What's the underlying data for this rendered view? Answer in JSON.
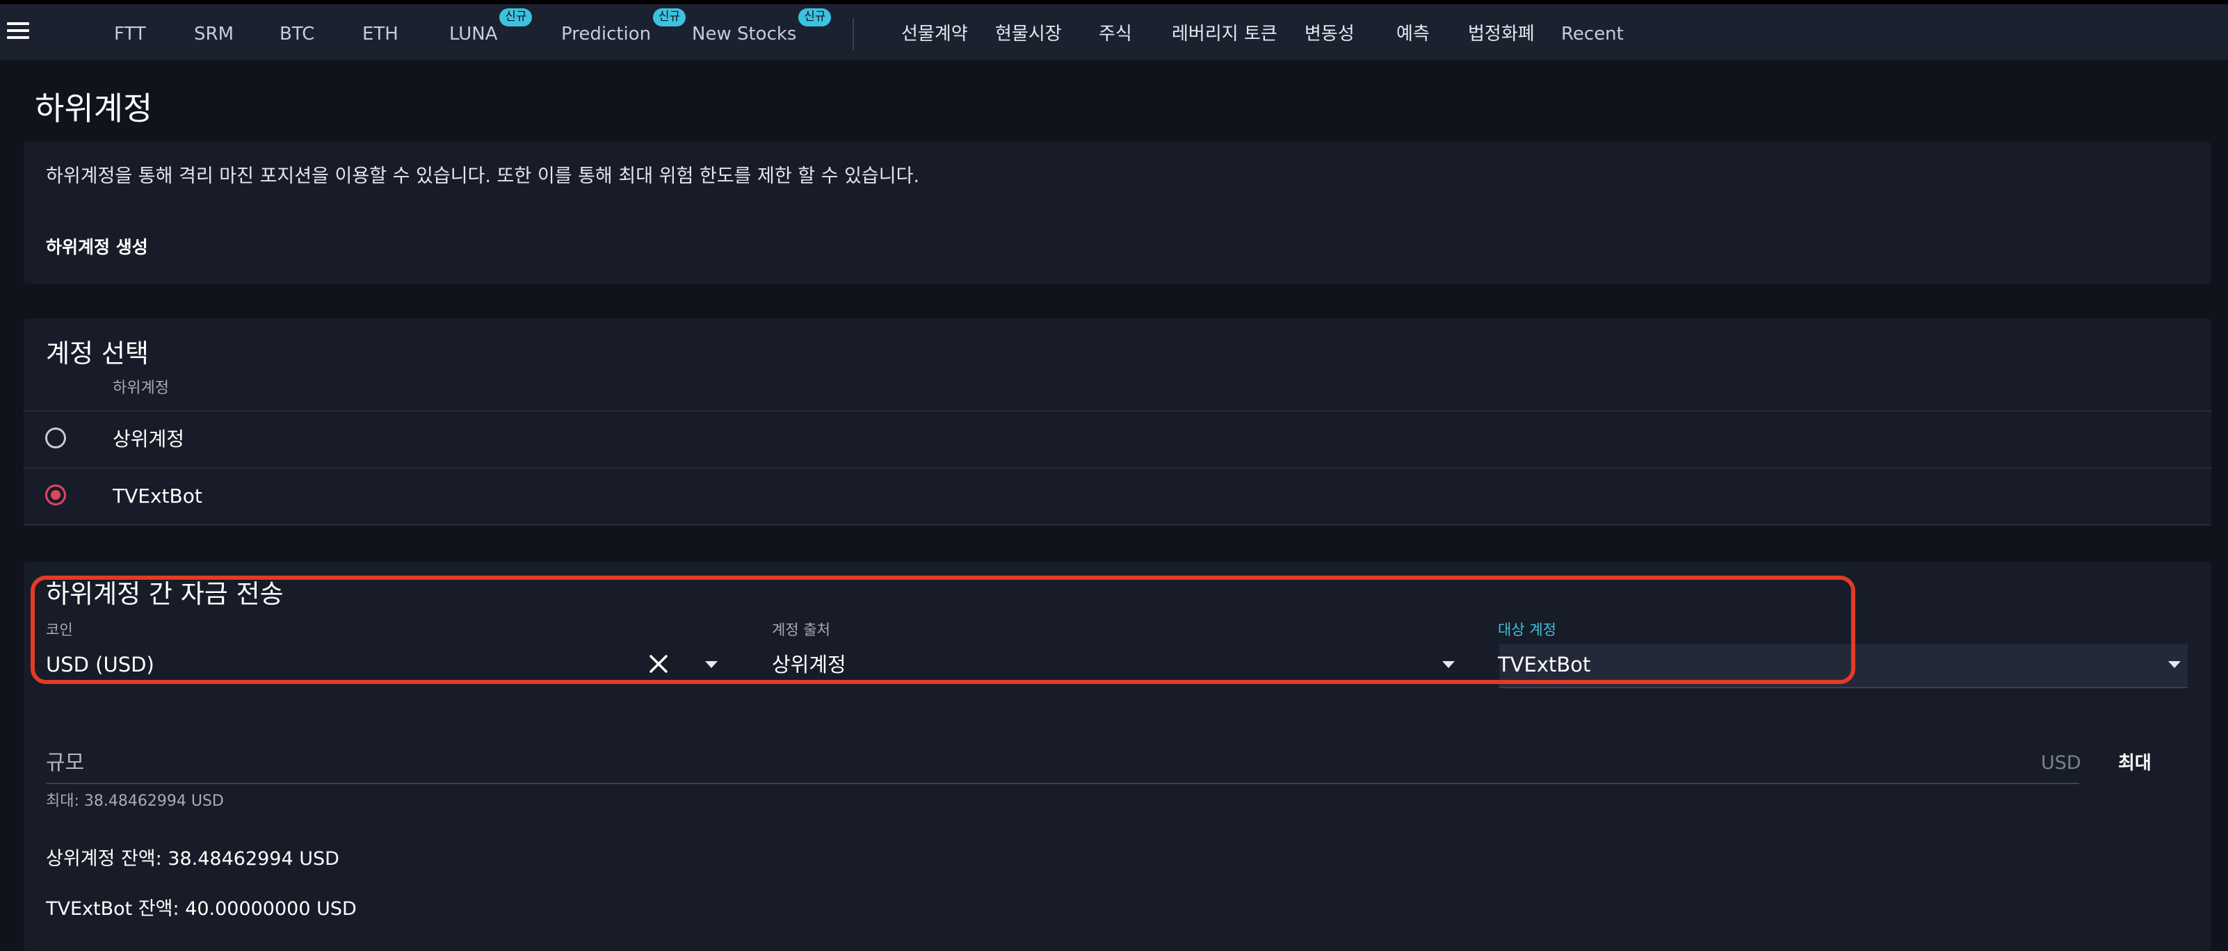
{
  "nav": {
    "items": [
      {
        "label": "FTT",
        "badge": ""
      },
      {
        "label": "SRM",
        "badge": ""
      },
      {
        "label": "BTC",
        "badge": ""
      },
      {
        "label": "ETH",
        "badge": ""
      },
      {
        "label": "LUNA",
        "badge": "신규"
      },
      {
        "label": "Prediction",
        "badge": "신규"
      },
      {
        "label": "New Stocks",
        "badge": "신규"
      }
    ],
    "items_kr": [
      "선물계약",
      "현물시장",
      "주식",
      "레버리지 토큰",
      "변동성",
      "예측",
      "법정화폐",
      "Recent"
    ]
  },
  "page": {
    "title": "하위계정"
  },
  "intro": {
    "description": "하위계정을 통해 격리 마진 포지션을 이용할 수 있습니다. 또한 이를 통해 최대 위험 한도를 제한 할 수 있습니다.",
    "create_label": "하위계정 생성"
  },
  "account_select": {
    "title": "계정 선택",
    "column_header": "하위계정",
    "rows": [
      {
        "label": "상위계정",
        "selected": false
      },
      {
        "label": "TVExtBot",
        "selected": true
      }
    ]
  },
  "transfer": {
    "title": "하위계정 간 자금 전송",
    "coin_label": "코인",
    "coin_value": "USD (USD)",
    "source_label": "계정 출처",
    "source_value": "상위계정",
    "target_label": "대상 계정",
    "target_value": "TVExtBot",
    "amount_placeholder": "규모",
    "amount_unit": "USD",
    "max_button": "최대",
    "max_hint": "최대: 38.48462994 USD",
    "balance_parent": "상위계정 잔액: 38.48462994 USD",
    "balance_sub": "TVExtBot 잔액: 40.00000000 USD"
  },
  "colors": {
    "accent": "#3cc3e0",
    "radio_selected": "#e0455f",
    "highlight_border": "#e23b26",
    "background": "#0f131c",
    "card": "#171c28"
  }
}
